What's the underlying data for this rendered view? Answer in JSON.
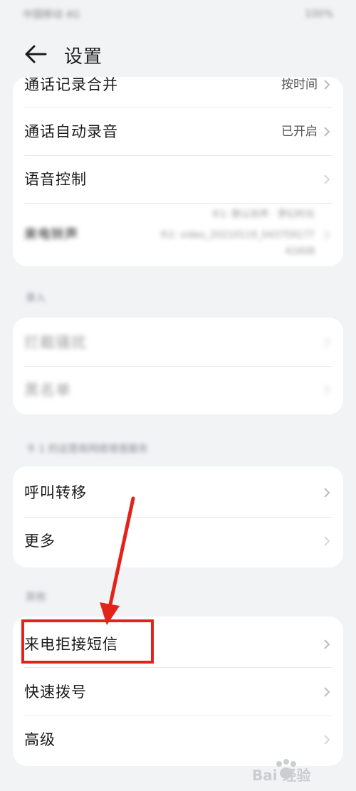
{
  "status_bar": {
    "left_text": "中国移动 4G",
    "right_text": "100%"
  },
  "header": {
    "title": "设置"
  },
  "card1": {
    "items": [
      {
        "label": "通话记录合并",
        "value": "按时间"
      },
      {
        "label": "通话自动录音",
        "value": "已开启"
      },
      {
        "label": "语音控制",
        "value": ""
      },
      {
        "label": "来电铃声",
        "value": "卡1: 默认铃声 · 梦幻时光",
        "value2": "卡2: video_20210119_043759177",
        "value3": "41608"
      }
    ]
  },
  "section2": {
    "title": "录入",
    "items": [
      {
        "label": "拦截骚扰"
      },
      {
        "label": "黑名单"
      }
    ]
  },
  "section3": {
    "title": "卡 1 的运营商网络增值服务",
    "items": [
      {
        "label": "呼叫转移"
      },
      {
        "label": "更多"
      }
    ]
  },
  "section4": {
    "title": "其他",
    "items": [
      {
        "label": "来电拒接短信"
      },
      {
        "label": "快速拨号"
      },
      {
        "label": "高级"
      }
    ]
  },
  "watermark": {
    "text": "Bai 经验"
  },
  "colors": {
    "background": "#f1f3f5",
    "card": "#ffffff",
    "annotation_red": "#e2231a"
  }
}
